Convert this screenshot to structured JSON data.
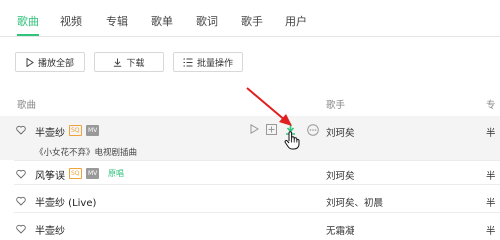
{
  "tabs": [
    {
      "label": "歌曲",
      "active": true
    },
    {
      "label": "视频"
    },
    {
      "label": "专辑"
    },
    {
      "label": "歌单"
    },
    {
      "label": "歌词"
    },
    {
      "label": "歌手"
    },
    {
      "label": "用户"
    }
  ],
  "toolbar": {
    "play_all": "播放全部",
    "download": "下载",
    "batch": "批量操作"
  },
  "table": {
    "col_song": "歌曲",
    "col_artist": "歌手",
    "col_album": "专"
  },
  "rows": [
    {
      "title": "半壶纱",
      "sq": "SQ",
      "mv": "MV",
      "subtitle": "《小女花不弃》电视剧插曲",
      "artist": "刘珂矣",
      "album": "半"
    },
    {
      "title": "风筝误",
      "sq": "SQ",
      "mv": "MV",
      "original": "原唱",
      "artist": "刘珂矣",
      "album": "半"
    },
    {
      "title": "半壶纱 (Live)",
      "artist": "刘珂矣、初晨",
      "album": "半"
    },
    {
      "title": "半壶纱",
      "artist": "无霜凝",
      "album": "半"
    }
  ],
  "colors": {
    "accent": "#31c27c",
    "badge": "#f0a33a",
    "annotation_arrow": "#e02020"
  },
  "icons": [
    "play-icon",
    "add-icon",
    "download-icon",
    "more-icon",
    "heart-icon",
    "hand-cursor-icon"
  ]
}
